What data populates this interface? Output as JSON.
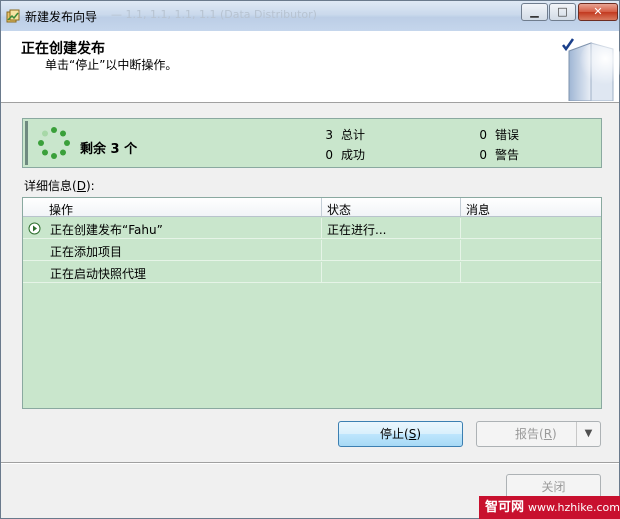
{
  "window": {
    "title": "新建发布向导",
    "ghost_title": "— 1.1, 1.1, 1.1, 1.1 (Data Distributor)",
    "minimize": "0",
    "maximize": "1",
    "close": "x"
  },
  "header": {
    "title": "正在创建发布",
    "subtitle": "单击“停止”以中断操作。"
  },
  "summary": {
    "remaining_label": "剩余 3 个",
    "total_num": "3",
    "total_label": "总计",
    "success_num": "0",
    "success_label": "成功",
    "error_num": "0",
    "error_label": "错误",
    "warning_num": "0",
    "warning_label": "警告"
  },
  "details": {
    "label_prefix": "详细信息",
    "label_key": "D",
    "label_suffix": "):",
    "columns": [
      "操作",
      "状态",
      "消息"
    ],
    "rows": [
      {
        "action": "正在创建发布“Fahu”",
        "status": "正在进行...",
        "message": "",
        "running": true
      },
      {
        "action": "正在添加项目",
        "status": "",
        "message": "",
        "running": false
      },
      {
        "action": "正在启动快照代理",
        "status": "",
        "message": "",
        "running": false
      }
    ]
  },
  "buttons": {
    "stop_prefix": "停止(",
    "stop_key": "S",
    "stop_suffix": ")",
    "report_prefix": "报告(",
    "report_key": "R",
    "report_suffix": ")",
    "report_arrow": "▼",
    "close": "关闭"
  },
  "watermark": {
    "brand": "智可网",
    "url": "www.hzhike.com"
  },
  "colors": {
    "panel_green": "#c9e6cc",
    "progress_green": "#3aa03a",
    "watermark_red": "#c8102e"
  }
}
